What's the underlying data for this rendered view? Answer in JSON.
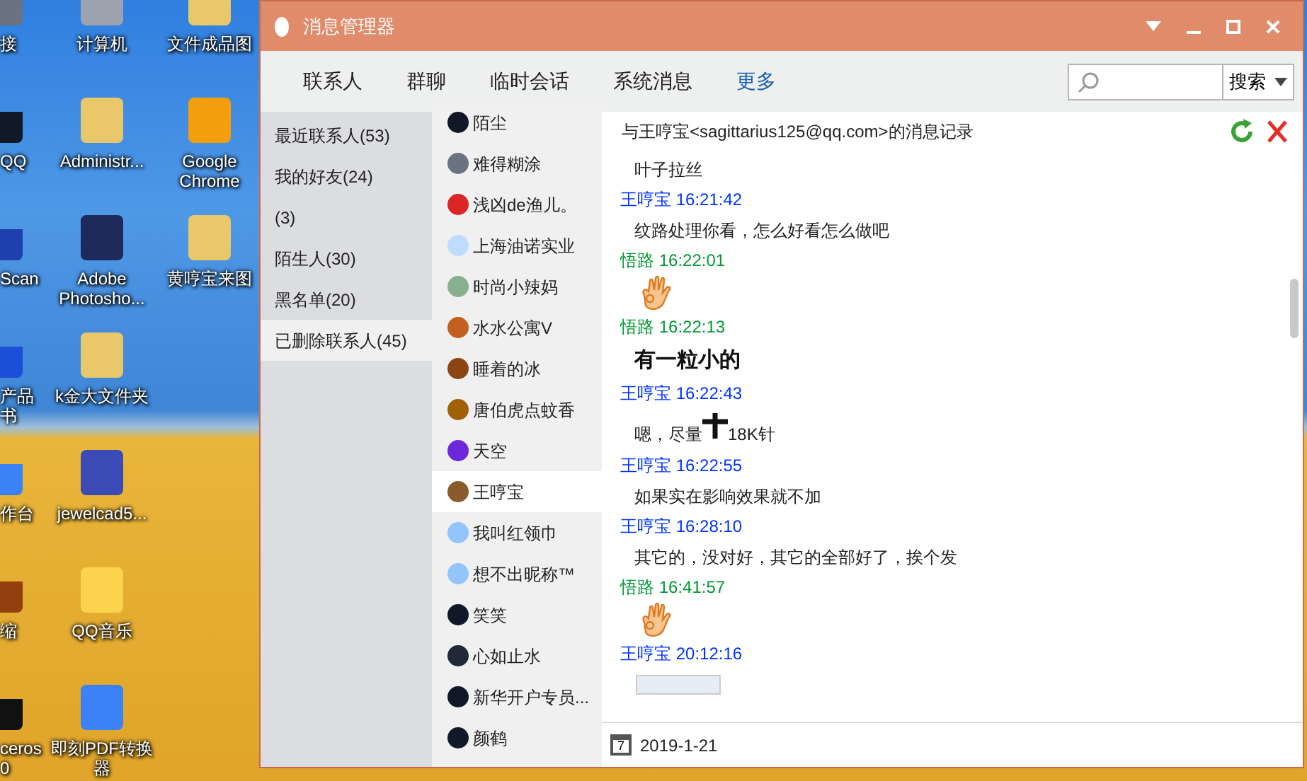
{
  "desktop": {
    "columns": [
      {
        "icons": [
          {
            "lines": [
              "接"
            ],
            "color": "#6b7280"
          },
          {
            "lines": [
              "QQ"
            ],
            "color": "#111827"
          },
          {
            "lines": [
              "Scan"
            ],
            "color": "#1e40af"
          },
          {
            "lines": [
              "产品",
              "书"
            ],
            "color": "#1d4ed8"
          },
          {
            "lines": [
              "作台"
            ],
            "color": "#3b82f6"
          },
          {
            "lines": [
              "缩"
            ],
            "color": "#92400e"
          },
          {
            "lines": [
              "ceros",
              "0"
            ],
            "color": "#111111"
          }
        ]
      },
      {
        "icons": [
          {
            "lines": [
              "计算机"
            ],
            "color": "#9ca3af"
          },
          {
            "lines": [
              "Administr..."
            ],
            "color": "#e8c86a"
          },
          {
            "lines": [
              "Adobe",
              "Photosho..."
            ],
            "color": "#1e2a5a"
          },
          {
            "lines": [
              "k金大文件夹"
            ],
            "color": "#e8c86a"
          },
          {
            "lines": [
              "jewelcad5..."
            ],
            "color": "#3b4bb5"
          },
          {
            "lines": [
              "QQ音乐"
            ],
            "color": "#fcd34d"
          },
          {
            "lines": [
              "即刻PDF转换",
              "器"
            ],
            "color": "#3b82f6"
          }
        ]
      },
      {
        "icons": [
          {
            "lines": [
              "文件成品图"
            ],
            "color": "#e8c86a"
          },
          {
            "lines": [
              "Google",
              "Chrome"
            ],
            "color": "#f59e0b"
          },
          {
            "lines": [
              "黄哼宝来图"
            ],
            "color": "#e8c86a"
          }
        ]
      }
    ]
  },
  "window": {
    "title": "消息管理器",
    "tabs": [
      {
        "label": "联系人",
        "selected": false
      },
      {
        "label": "群聊",
        "selected": false
      },
      {
        "label": "临时会话",
        "selected": false
      },
      {
        "label": "系统消息",
        "selected": false
      },
      {
        "label": "更多",
        "selected": true
      }
    ],
    "search": {
      "button": "搜索"
    },
    "categories": [
      {
        "label": "最近联系人(53)",
        "selected": false
      },
      {
        "label": "我的好友(24)",
        "selected": false
      },
      {
        "label": "(3)",
        "selected": false
      },
      {
        "label": "陌生人(30)",
        "selected": false
      },
      {
        "label": "黑名单(20)",
        "selected": false
      },
      {
        "label": "已删除联系人(45)",
        "selected": true
      }
    ],
    "contacts": [
      {
        "name": "陌尘",
        "selected": false,
        "color": "#111827"
      },
      {
        "name": "难得糊涂",
        "selected": false,
        "color": "#6b7280"
      },
      {
        "name": "浅凶de渔儿。",
        "selected": false,
        "color": "#dc2626"
      },
      {
        "name": "上海油诺实业",
        "selected": false,
        "color": "#bfdbfe"
      },
      {
        "name": "时尚小辣妈",
        "selected": false,
        "color": "#86b08f"
      },
      {
        "name": "水水公寓V",
        "selected": false,
        "color": "#c2611f"
      },
      {
        "name": "睡着的冰",
        "selected": false,
        "color": "#8b4513"
      },
      {
        "name": "唐伯虎点蚊香",
        "selected": false,
        "color": "#a16207"
      },
      {
        "name": "天空",
        "selected": false,
        "color": "#6d28d9"
      },
      {
        "name": "王哼宝",
        "selected": true,
        "color": "#8b5a2b"
      },
      {
        "name": "我叫红领巾",
        "selected": false,
        "color": "#93c5fd"
      },
      {
        "name": "想不出昵称™",
        "selected": false,
        "color": "#93c5fd"
      },
      {
        "name": "笑笑",
        "selected": false,
        "color": "#111827"
      },
      {
        "name": "心如止水",
        "selected": false,
        "color": "#1f2937"
      },
      {
        "name": "新华开户专员...",
        "selected": false,
        "color": "#111827"
      },
      {
        "name": "颜鹤",
        "selected": false,
        "color": "#111827"
      }
    ],
    "log": {
      "title": "与王哼宝<sagittarius125@qq.com>的消息记录",
      "messages": [
        {
          "kind": "text",
          "text": "叶子拉丝"
        },
        {
          "kind": "header",
          "sender": "王哼宝",
          "time": "16:21:42",
          "color": "#0033ff"
        },
        {
          "kind": "text",
          "text": "纹路处理你看，怎么好看怎么做吧"
        },
        {
          "kind": "header",
          "sender": "悟路",
          "time": "16:22:01",
          "color": "#009933"
        },
        {
          "kind": "emoji"
        },
        {
          "kind": "header",
          "sender": "悟路",
          "time": "16:22:13",
          "color": "#009933"
        },
        {
          "kind": "bold",
          "text": "有一粒小的"
        },
        {
          "kind": "header",
          "sender": "王哼宝",
          "time": "16:22:43",
          "color": "#0033ff"
        },
        {
          "kind": "plus",
          "before": "嗯，尽量",
          "after": "18K针"
        },
        {
          "kind": "header",
          "sender": "王哼宝",
          "time": "16:22:55",
          "color": "#0033ff"
        },
        {
          "kind": "text",
          "text": "如果实在影响效果就不加"
        },
        {
          "kind": "header",
          "sender": "王哼宝",
          "time": "16:28:10",
          "color": "#0033ff"
        },
        {
          "kind": "text",
          "text": "其它的，没对好，其它的全部好了，挨个发"
        },
        {
          "kind": "header",
          "sender": "悟路",
          "time": "16:41:57",
          "color": "#009933"
        },
        {
          "kind": "emoji"
        },
        {
          "kind": "header",
          "sender": "王哼宝",
          "time": "20:12:16",
          "color": "#0033ff"
        },
        {
          "kind": "image"
        }
      ],
      "calendar_day": "7",
      "date": "2019-1-21"
    }
  }
}
